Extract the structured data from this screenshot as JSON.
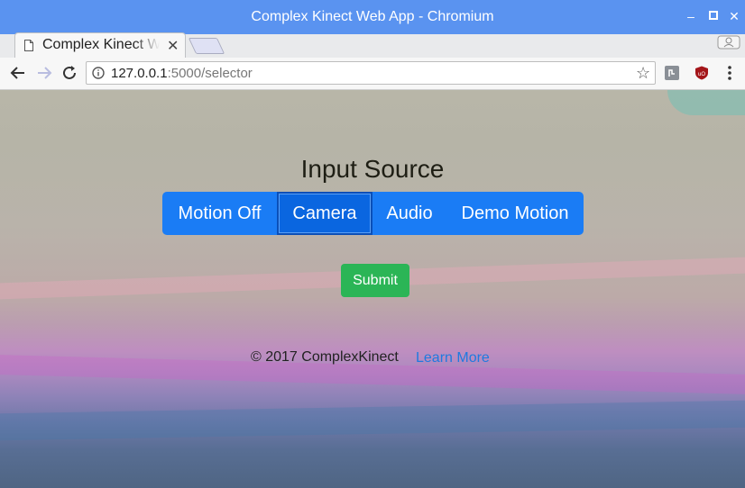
{
  "window": {
    "title": "Complex Kinect Web App - Chromium"
  },
  "tab": {
    "title": "Complex Kinect Web App"
  },
  "address_bar": {
    "host": "127.0.0.1",
    "path": ":5000/selector"
  },
  "page": {
    "heading": "Input Source",
    "sources": [
      "Motion Off",
      "Camera",
      "Audio",
      "Demo Motion"
    ],
    "selected_source": "Camera",
    "submit_label": "Submit",
    "footer_copyright": "© 2017 ComplexKinect",
    "footer_link": "Learn More"
  },
  "colors": {
    "titlebar": "#5a93f0",
    "button_group": "#1a7cf5",
    "submit": "#2bb556",
    "link": "#1f7ae0"
  }
}
